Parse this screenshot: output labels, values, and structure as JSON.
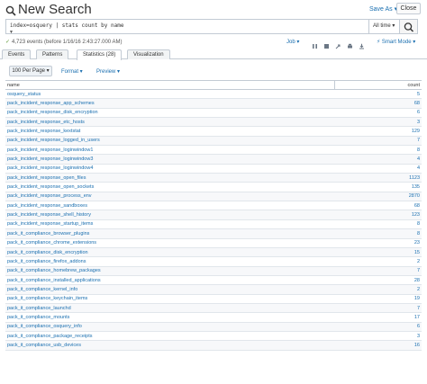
{
  "header": {
    "title": "New Search",
    "save_as": "Save As ▾",
    "close": "Close"
  },
  "search": {
    "query": "index=osquery | stats count by name",
    "time_range": "All time ▾"
  },
  "job": {
    "status": "4,723 events (before 1/16/16 2:43:27.000 AM)",
    "job_menu": "Job ▾",
    "mode": "⚡ Smart Mode ▾"
  },
  "tabs": [
    {
      "label": "Events"
    },
    {
      "label": "Patterns"
    },
    {
      "label": "Statistics (28)"
    },
    {
      "label": "Visualization"
    }
  ],
  "results_toolbar": {
    "per_page": "100 Per Page ▾",
    "format": "Format ▾",
    "preview": "Preview ▾"
  },
  "table": {
    "columns": [
      "name",
      "count"
    ],
    "rows": [
      {
        "name": "osquery_status",
        "count": "5"
      },
      {
        "name": "pack_incident_response_app_schemes",
        "count": "68"
      },
      {
        "name": "pack_incident_response_disk_encryption",
        "count": "6"
      },
      {
        "name": "pack_incident_response_etc_hosts",
        "count": "3"
      },
      {
        "name": "pack_incident_response_kextstat",
        "count": "129"
      },
      {
        "name": "pack_incident_response_logged_in_users",
        "count": "7"
      },
      {
        "name": "pack_incident_response_loginwindow1",
        "count": "8"
      },
      {
        "name": "pack_incident_response_loginwindow3",
        "count": "4"
      },
      {
        "name": "pack_incident_response_loginwindow4",
        "count": "4"
      },
      {
        "name": "pack_incident_response_open_files",
        "count": "1123"
      },
      {
        "name": "pack_incident_response_open_sockets",
        "count": "135"
      },
      {
        "name": "pack_incident_response_process_env",
        "count": "2870"
      },
      {
        "name": "pack_incident_response_sandboxes",
        "count": "68"
      },
      {
        "name": "pack_incident_response_shell_history",
        "count": "123"
      },
      {
        "name": "pack_incident_response_startup_items",
        "count": "8"
      },
      {
        "name": "pack_it_compliance_browser_plugins",
        "count": "8"
      },
      {
        "name": "pack_it_compliance_chrome_extensions",
        "count": "23"
      },
      {
        "name": "pack_it_compliance_disk_encryption",
        "count": "15"
      },
      {
        "name": "pack_it_compliance_firefox_addons",
        "count": "2"
      },
      {
        "name": "pack_it_compliance_homebrew_packages",
        "count": "7"
      },
      {
        "name": "pack_it_compliance_installed_applications",
        "count": "28"
      },
      {
        "name": "pack_it_compliance_kernel_info",
        "count": "2"
      },
      {
        "name": "pack_it_compliance_keychain_items",
        "count": "19"
      },
      {
        "name": "pack_it_compliance_launchd",
        "count": "7"
      },
      {
        "name": "pack_it_compliance_mounts",
        "count": "17"
      },
      {
        "name": "pack_it_compliance_osquery_info",
        "count": "6"
      },
      {
        "name": "pack_it_compliance_package_receipts",
        "count": "3"
      },
      {
        "name": "pack_it_compliance_usb_devices",
        "count": "16"
      }
    ]
  },
  "colors": {
    "link": "#1a6fb0",
    "success": "#5c9732",
    "border": "#c3cbd4"
  }
}
